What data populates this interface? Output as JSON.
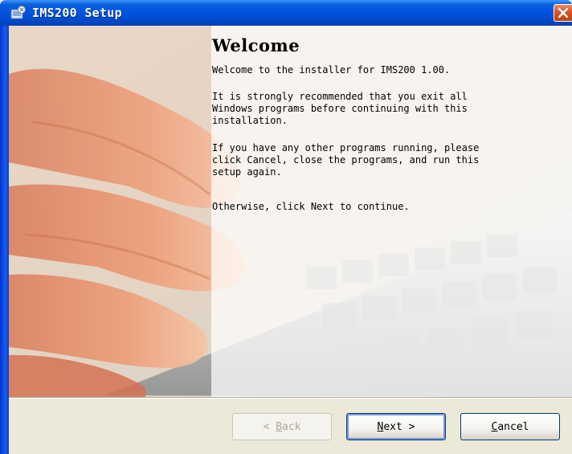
{
  "window": {
    "title": "IMS200 Setup",
    "app_icon": "setup-icon",
    "close_icon": "close-icon"
  },
  "welcome": {
    "heading": "Welcome",
    "intro": "Welcome to the installer for IMS200 1.00.",
    "recommendation": "It is strongly recommended that you exit all\nWindows programs before continuing with this\ninstallation.",
    "other_programs": "If you have any other programs running, please\nclick Cancel, close the programs, and run this\nsetup again.",
    "continue": "Otherwise, click Next to continue."
  },
  "buttons": {
    "back": {
      "prefix": "< ",
      "accel": "B",
      "rest": "ack",
      "enabled": false
    },
    "next": {
      "accel": "N",
      "rest": "ext >",
      "enabled": true
    },
    "cancel": {
      "accel": "C",
      "rest": "ancel",
      "enabled": true
    }
  },
  "colors": {
    "titlebar": "#0054e3",
    "dialog_bg": "#ece9d8",
    "close_button": "#d6501f",
    "button_border": "#003c74"
  }
}
